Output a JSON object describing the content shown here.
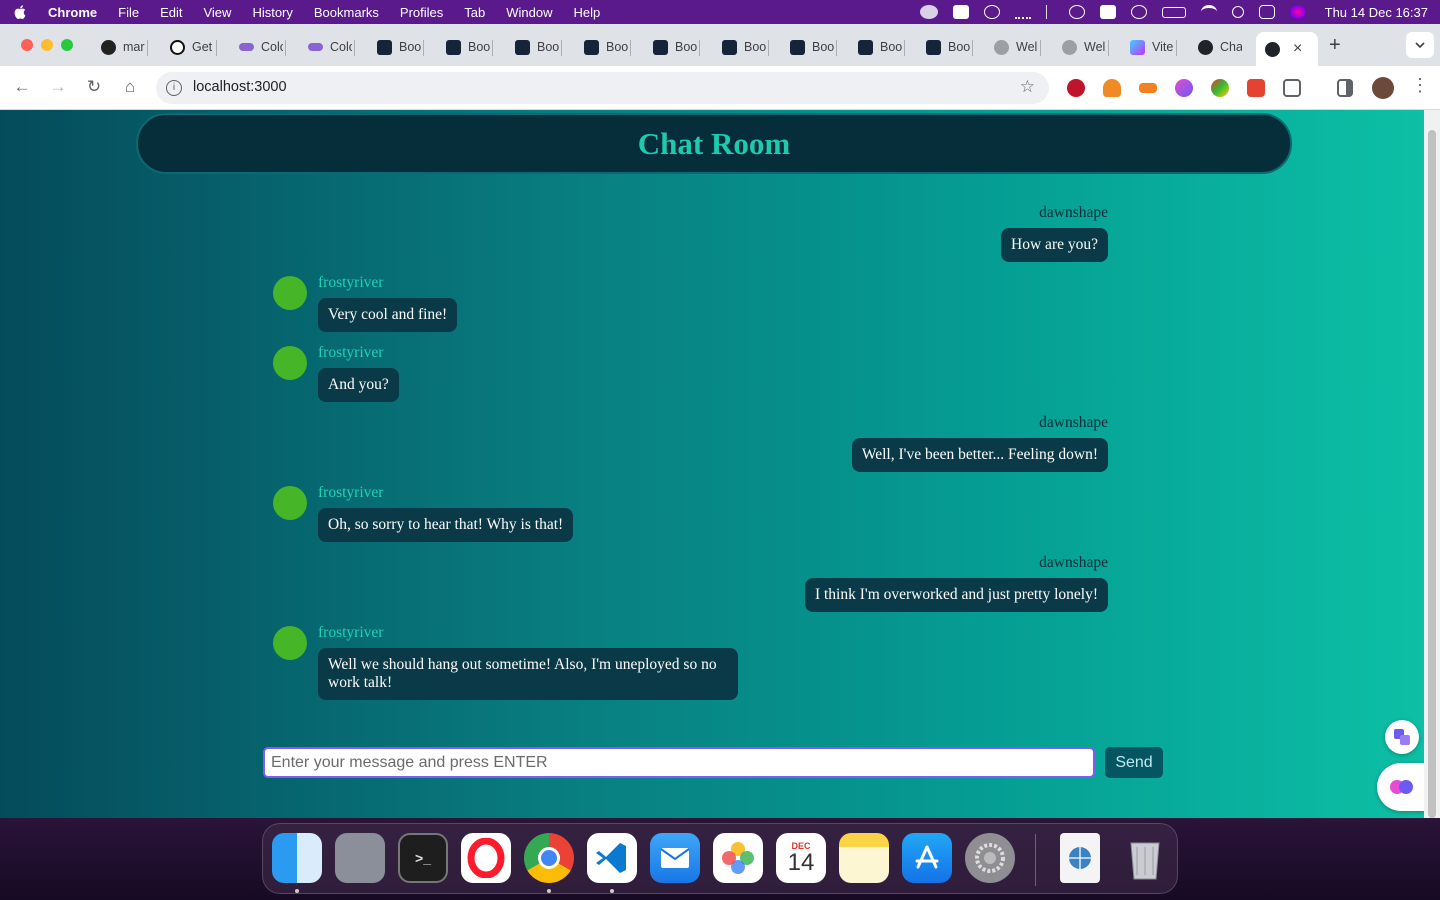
{
  "menubar": {
    "app": "Chrome",
    "items": [
      "File",
      "Edit",
      "View",
      "History",
      "Bookmarks",
      "Profiles",
      "Tab",
      "Window",
      "Help"
    ],
    "clock": "Thu 14 Dec  16:37",
    "status_icons": [
      "creative-cloud-icon",
      "acrobat-icon",
      "one-password-icon",
      "wifi-dots-icon",
      "bluetooth-icon",
      "time-machine-icon",
      "hr-icon",
      "user-icon",
      "battery-icon",
      "wifi-icon",
      "spotlight-icon",
      "control-center-icon",
      "siri-icon"
    ]
  },
  "tabs": [
    {
      "label": "mar",
      "icon": "github-icon"
    },
    {
      "label": "Get",
      "icon": "threads-icon"
    },
    {
      "label": "Colo",
      "icon": "cloud-icon"
    },
    {
      "label": "Colo",
      "icon": "cloud-icon"
    },
    {
      "label": "Boo",
      "icon": "b-icon"
    },
    {
      "label": "Boo",
      "icon": "b-icon"
    },
    {
      "label": "Boo",
      "icon": "b-icon"
    },
    {
      "label": "Boo",
      "icon": "b-icon"
    },
    {
      "label": "Boo",
      "icon": "b-icon"
    },
    {
      "label": "Boo",
      "icon": "b-icon"
    },
    {
      "label": "Boo",
      "icon": "b-icon"
    },
    {
      "label": "Boo",
      "icon": "b-icon"
    },
    {
      "label": "Boo",
      "icon": "b-icon"
    },
    {
      "label": "Wel",
      "icon": "globe-icon"
    },
    {
      "label": "Wel",
      "icon": "globe-icon"
    },
    {
      "label": "Vite",
      "icon": "vite-icon"
    },
    {
      "label": "Cha",
      "icon": "react-icon"
    }
  ],
  "active_tab_close": "×",
  "new_tab": "+",
  "address": {
    "url": "localhost:3000"
  },
  "chat": {
    "title": "Chat Room",
    "messages": [
      {
        "user": "dawnshape",
        "text": "How are you?",
        "side": "right"
      },
      {
        "user": "frostyriver",
        "text": "Very cool and fine!",
        "side": "left"
      },
      {
        "user": "frostyriver",
        "text": "And you?",
        "side": "left"
      },
      {
        "user": "dawnshape",
        "text": "Well, I've been better... Feeling down!",
        "side": "right"
      },
      {
        "user": "frostyriver",
        "text": "Oh, so sorry to hear that! Why is that!",
        "side": "left"
      },
      {
        "user": "dawnshape",
        "text": "I think I'm overworked and just pretty lonely!",
        "side": "right"
      },
      {
        "user": "frostyriver",
        "text": "Well we should hang out sometime! Also, I'm uneployed so no work talk!",
        "side": "left"
      }
    ],
    "input_placeholder": "Enter your message and press ENTER",
    "send_label": "Send"
  },
  "dock": {
    "apps": [
      "finder-icon",
      "launchpad-icon",
      "terminal-icon",
      "opera-icon",
      "chrome-icon",
      "vscode-icon",
      "mail-icon",
      "photos-icon",
      "calendar-icon",
      "notes-icon",
      "app-store-icon",
      "system-settings-icon",
      "web-archive-icon",
      "trash-icon"
    ],
    "calendar_month": "DEC",
    "calendar_day": "14"
  }
}
